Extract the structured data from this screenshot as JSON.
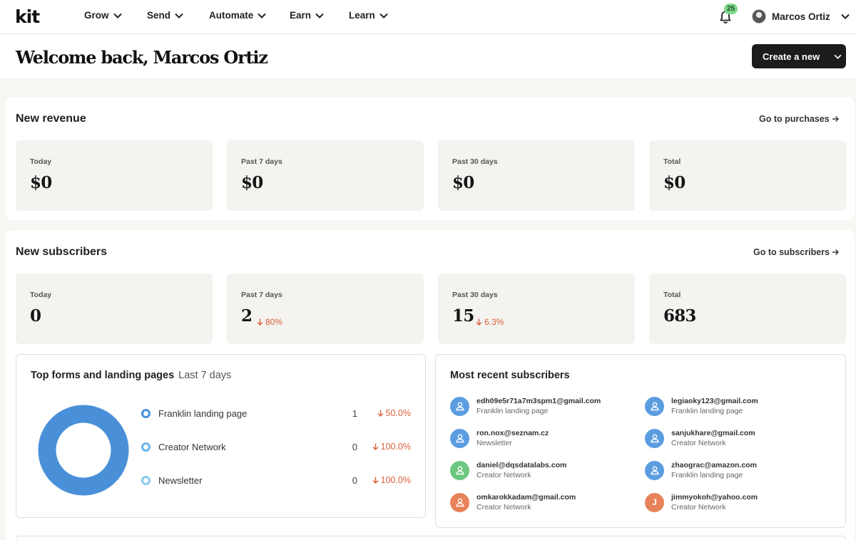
{
  "nav": {
    "brand": "Kit",
    "items": [
      {
        "label": "Grow"
      },
      {
        "label": "Send"
      },
      {
        "label": "Automate"
      },
      {
        "label": "Earn"
      },
      {
        "label": "Learn"
      }
    ],
    "notifications_count": "25",
    "user_name": "Marcos Ortiz"
  },
  "header": {
    "welcome": "Welcome back, Marcos Ortiz",
    "create_label": "Create a new"
  },
  "revenue": {
    "title": "New revenue",
    "link": "Go to purchases",
    "stats": [
      {
        "label": "Today",
        "value": "$0"
      },
      {
        "label": "Past 7 days",
        "value": "$0"
      },
      {
        "label": "Past 30 days",
        "value": "$0"
      },
      {
        "label": "Total",
        "value": "$0"
      }
    ]
  },
  "subscribers": {
    "title": "New subscribers",
    "link": "Go to subscribers",
    "stats": [
      {
        "label": "Today",
        "value": "0",
        "change": ""
      },
      {
        "label": "Past 7 days",
        "value": "2",
        "change": "80%"
      },
      {
        "label": "Past 30 days",
        "value": "15",
        "change": "6.3%"
      },
      {
        "label": "Total",
        "value": "683",
        "change": ""
      }
    ]
  },
  "top_forms": {
    "title": "Top forms and landing pages",
    "period": "Last 7 days",
    "donut_color": "#4a90d9",
    "items": [
      {
        "name": "Franklin landing page",
        "count": "1",
        "change": "50.0%",
        "color": "#4a90d9"
      },
      {
        "name": "Creator Network",
        "count": "0",
        "change": "100.0%",
        "color": "#6cb3e8"
      },
      {
        "name": "Newsletter",
        "count": "0",
        "change": "100.0%",
        "color": "#8cc8ee"
      }
    ]
  },
  "recent": {
    "title": "Most recent subscribers",
    "items": [
      {
        "email": "edh09e5r71a7m3spm1@gmail.com",
        "source": "Franklin landing page",
        "avatar_color": "#5b9de0",
        "initial": ""
      },
      {
        "email": "legiaoky123@gmail.com",
        "source": "Franklin landing page",
        "avatar_color": "#5b9de0",
        "initial": ""
      },
      {
        "email": "ron.nox@seznam.cz",
        "source": "Newsletter",
        "avatar_color": "#5b9de0",
        "initial": ""
      },
      {
        "email": "sanjukhare@gmail.com",
        "source": "Creator Network",
        "avatar_color": "#5b9de0",
        "initial": ""
      },
      {
        "email": "daniel@dqsdatalabs.com",
        "source": "Creator Network",
        "avatar_color": "#6cc780",
        "initial": ""
      },
      {
        "email": "zhaograc@amazon.com",
        "source": "Franklin landing page",
        "avatar_color": "#5b9de0",
        "initial": ""
      },
      {
        "email": "omkarokkadam@gmail.com",
        "source": "Creator Network",
        "avatar_color": "#e8825a",
        "initial": ""
      },
      {
        "email": "jimmyokoh@yahoo.com",
        "source": "Creator Network",
        "avatar_color": "#e8825a",
        "initial": "J"
      }
    ]
  }
}
